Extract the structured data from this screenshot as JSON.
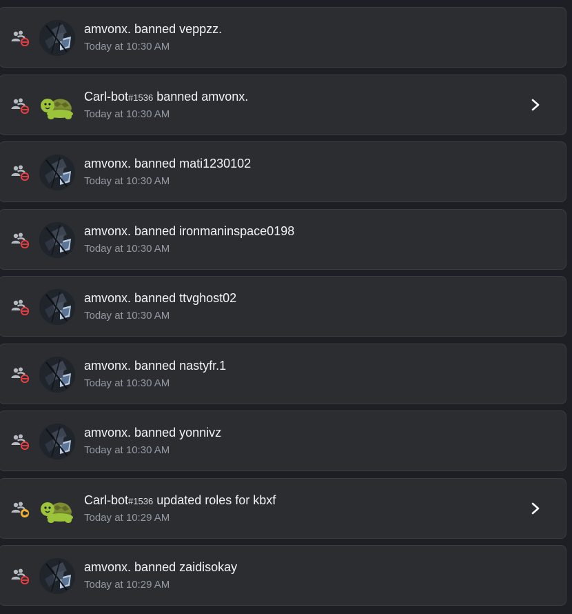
{
  "audit_log": {
    "entries": [
      {
        "actor": "amvonx.",
        "tag": "",
        "action": "banned veppzz.",
        "time": "Today at 10:30 AM",
        "action_type": "ban",
        "avatar": "moth-avatar",
        "expandable": false
      },
      {
        "actor": "Carl-bot",
        "tag": "#1536",
        "action": "banned amvonx.",
        "time": "Today at 10:30 AM",
        "action_type": "ban",
        "avatar": "turtle-avatar",
        "expandable": true
      },
      {
        "actor": "amvonx.",
        "tag": "",
        "action": "banned mati1230102",
        "time": "Today at 10:30 AM",
        "action_type": "ban",
        "avatar": "moth-avatar",
        "expandable": false
      },
      {
        "actor": "amvonx.",
        "tag": "",
        "action": "banned ironmaninspace0198",
        "time": "Today at 10:30 AM",
        "action_type": "ban",
        "avatar": "moth-avatar",
        "expandable": false
      },
      {
        "actor": "amvonx.",
        "tag": "",
        "action": "banned ttvghost02",
        "time": "Today at 10:30 AM",
        "action_type": "ban",
        "avatar": "moth-avatar",
        "expandable": false
      },
      {
        "actor": "amvonx.",
        "tag": "",
        "action": "banned nastyfr.1",
        "time": "Today at 10:30 AM",
        "action_type": "ban",
        "avatar": "moth-avatar",
        "expandable": false
      },
      {
        "actor": "amvonx.",
        "tag": "",
        "action": "banned yonnivz",
        "time": "Today at 10:30 AM",
        "action_type": "ban",
        "avatar": "moth-avatar",
        "expandable": false
      },
      {
        "actor": "Carl-bot",
        "tag": "#1536",
        "action": "updated roles for kbxf",
        "time": "Today at 10:29 AM",
        "action_type": "role-update",
        "avatar": "turtle-avatar",
        "expandable": true
      },
      {
        "actor": "amvonx.",
        "tag": "",
        "action": "banned zaidisokay",
        "time": "Today at 10:29 AM",
        "action_type": "ban",
        "avatar": "moth-avatar",
        "expandable": false
      }
    ]
  },
  "colors": {
    "page_bg": "#1e1f24",
    "card_bg": "#2b2d31",
    "card_border": "#3a3c42",
    "text_primary": "#f2f3f5",
    "text_muted": "#949ba4",
    "ban_red": "#f23f43",
    "role_update_orange": "#f0b232",
    "turtle_green": "#9cc43a"
  }
}
